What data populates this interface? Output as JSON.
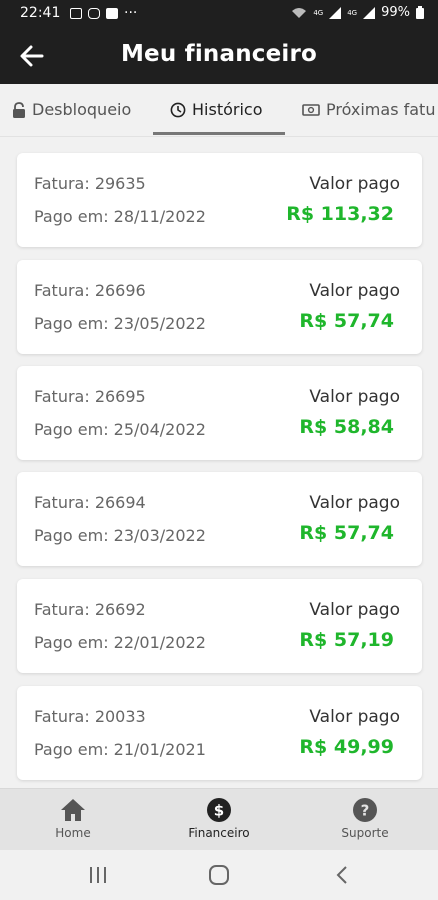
{
  "status_bar": {
    "time": "22:41",
    "dots": "···",
    "signal_a": "4G",
    "signal_b": "4G",
    "battery": "99%"
  },
  "app_bar": {
    "title": "Meu financeiro",
    "back_icon": "arrow-left-icon"
  },
  "tabs": [
    {
      "label": "Desbloqueio",
      "icon": "lock-icon",
      "active": false
    },
    {
      "label": "Histórico",
      "icon": "clock-icon",
      "active": true
    },
    {
      "label": "Próximas fatu",
      "icon": "bill-icon",
      "active": false
    }
  ],
  "invoices": [
    {
      "invoice": "Fatura: 29635",
      "paid_on": "Pago em: 28/11/2022",
      "paid_label": "Valor pago",
      "amount": "R$ 113,32"
    },
    {
      "invoice": "Fatura: 26696",
      "paid_on": "Pago em: 23/05/2022",
      "paid_label": "Valor pago",
      "amount": "R$ 57,74"
    },
    {
      "invoice": "Fatura: 26695",
      "paid_on": "Pago em: 25/04/2022",
      "paid_label": "Valor pago",
      "amount": "R$ 58,84"
    },
    {
      "invoice": "Fatura: 26694",
      "paid_on": "Pago em: 23/03/2022",
      "paid_label": "Valor pago",
      "amount": "R$ 57,74"
    },
    {
      "invoice": "Fatura: 26692",
      "paid_on": "Pago em: 22/01/2022",
      "paid_label": "Valor pago",
      "amount": "R$ 57,19"
    },
    {
      "invoice": "Fatura: 20033",
      "paid_on": "Pago em: 21/01/2021",
      "paid_label": "Valor pago",
      "amount": "R$ 49,99"
    }
  ],
  "bottom_nav": [
    {
      "label": "Home",
      "icon": "home-icon",
      "active": false
    },
    {
      "label": "Financeiro",
      "icon": "dollar-circle-icon",
      "active": true
    },
    {
      "label": "Suporte",
      "icon": "help-circle-icon",
      "active": false
    }
  ],
  "colors": {
    "app_bar": "#1f1f1f",
    "amount_green": "#1fb62c",
    "background": "#f1f1f1"
  }
}
